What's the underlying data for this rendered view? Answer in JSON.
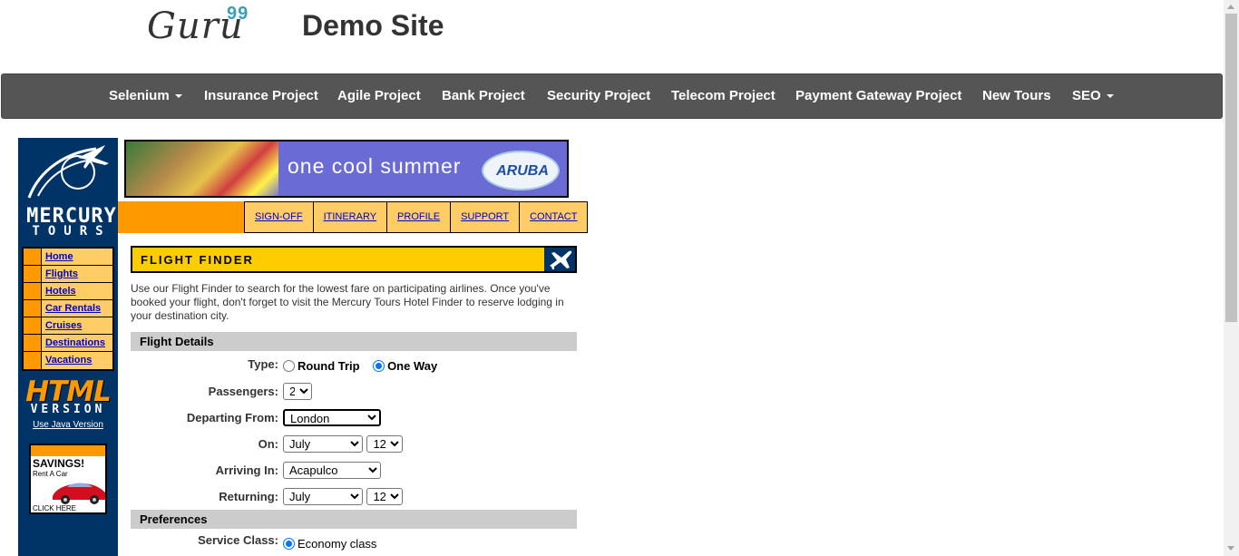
{
  "header": {
    "logo_text": "Guru",
    "logo_sup": "99",
    "site_title": "Demo Site"
  },
  "navbar": {
    "items": [
      {
        "label": "Selenium",
        "dropdown": true
      },
      {
        "label": "Insurance Project",
        "dropdown": false
      },
      {
        "label": "Agile Project",
        "dropdown": false
      },
      {
        "label": "Bank Project",
        "dropdown": false
      },
      {
        "label": "Security Project",
        "dropdown": false
      },
      {
        "label": "Telecom Project",
        "dropdown": false
      },
      {
        "label": "Payment Gateway Project",
        "dropdown": false
      },
      {
        "label": "New Tours",
        "dropdown": false
      },
      {
        "label": "SEO",
        "dropdown": true
      }
    ]
  },
  "mercury": {
    "brand_line1": "MERCURY",
    "brand_line2": "TOURS",
    "side_nav": [
      "Home",
      "Flights",
      "Hotels",
      "Car Rentals",
      "Cruises",
      "Destinations",
      "Vacations"
    ],
    "html_big": "HTML",
    "html_version": "VERSION",
    "java_link": "Use Java Version",
    "ad": {
      "title": "SAVINGS!",
      "sub": "Rent A Car",
      "cta": "CLICK HERE"
    },
    "banner_text": "one cool summer",
    "banner_logo": "ARUBA",
    "top_nav": [
      "SIGN-OFF",
      "ITINERARY",
      "PROFILE",
      "SUPPORT",
      "CONTACT"
    ]
  },
  "finder": {
    "title": "FLIGHT FINDER",
    "intro": "Use our Flight Finder to search for the lowest fare on participating airlines. Once you've booked your flight, don't forget to visit the Mercury Tours Hotel Finder to reserve lodging in your destination city.",
    "section_details": "Flight Details",
    "type_label": "Type:",
    "type_options": [
      "Round Trip",
      "One Way"
    ],
    "type_selected": "One Way",
    "passengers_label": "Passengers:",
    "passengers_value": "2",
    "departing_label": "Departing From:",
    "departing_value": "London",
    "on_label": "On:",
    "on_month": "July",
    "on_day": "12",
    "arriving_label": "Arriving In:",
    "arriving_value": "Acapulco",
    "returning_label": "Returning:",
    "returning_month": "July",
    "returning_day": "12",
    "section_prefs": "Preferences",
    "service_label": "Service Class:",
    "service_value": "Economy class"
  },
  "colors": {
    "navbar_bg": "#555555",
    "mercury_blue": "#003366",
    "orange": "#ff9900",
    "yellow": "#ffcc00",
    "link_blue": "#0000cc"
  }
}
